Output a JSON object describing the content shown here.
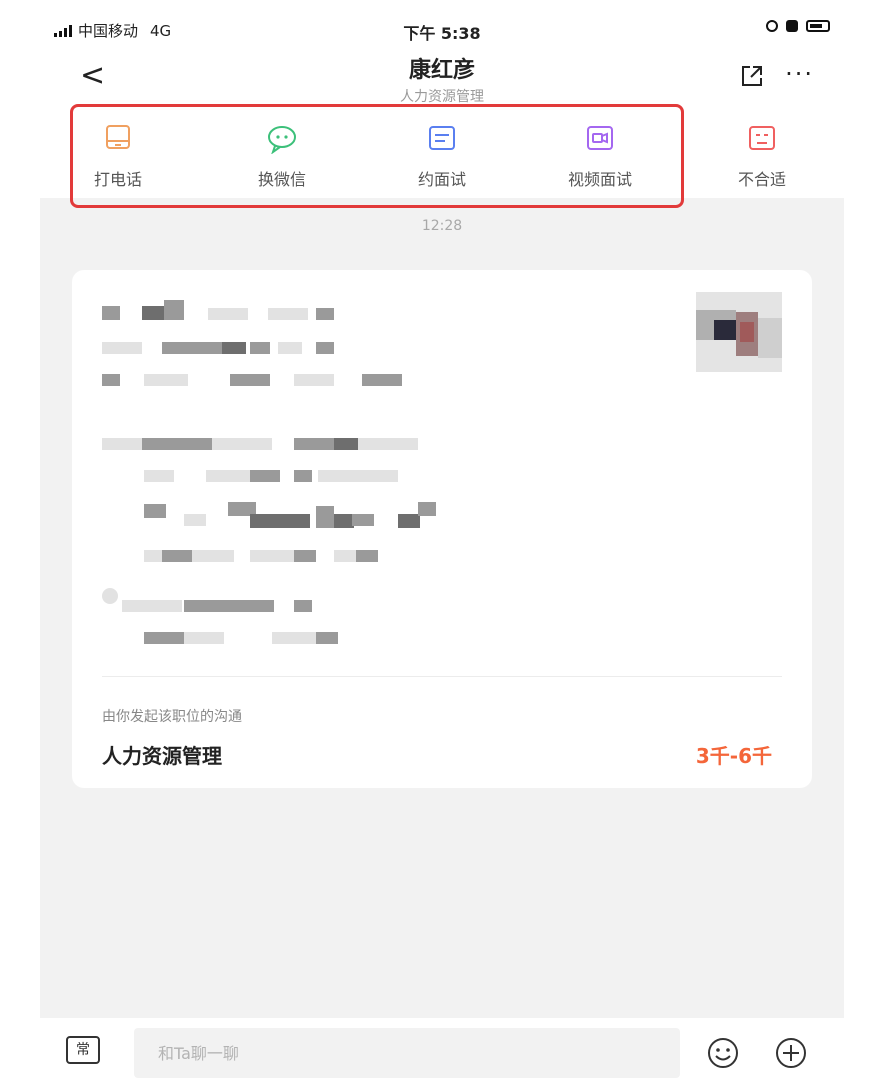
{
  "status": {
    "carrier": "中国移动",
    "network": "4G",
    "time": "下午 5:38"
  },
  "header": {
    "back_label": "<",
    "title": "康红彦",
    "subtitle": "人力资源管理",
    "more_label": "···"
  },
  "actions": [
    {
      "label": "打电话",
      "icon": "phone-icon",
      "color": "#f0a060"
    },
    {
      "label": "换微信",
      "icon": "wechat-icon",
      "color": "#3cc07a"
    },
    {
      "label": "约面试",
      "icon": "interview-icon",
      "color": "#5a7ff0"
    },
    {
      "label": "视频面试",
      "icon": "video-icon",
      "color": "#a467f0"
    },
    {
      "label": "不合适",
      "icon": "unsuitable-icon",
      "color": "#f06060"
    }
  ],
  "highlight_color": "#e23a3a",
  "chat": {
    "timestamp": "12:28",
    "card": {
      "hint": "由你发起该职位的沟通",
      "job_title": "人力资源管理",
      "salary": "3千-6千",
      "salary_color": "#f4663a"
    }
  },
  "input": {
    "common_label": "常",
    "placeholder": "和Ta聊一聊"
  }
}
